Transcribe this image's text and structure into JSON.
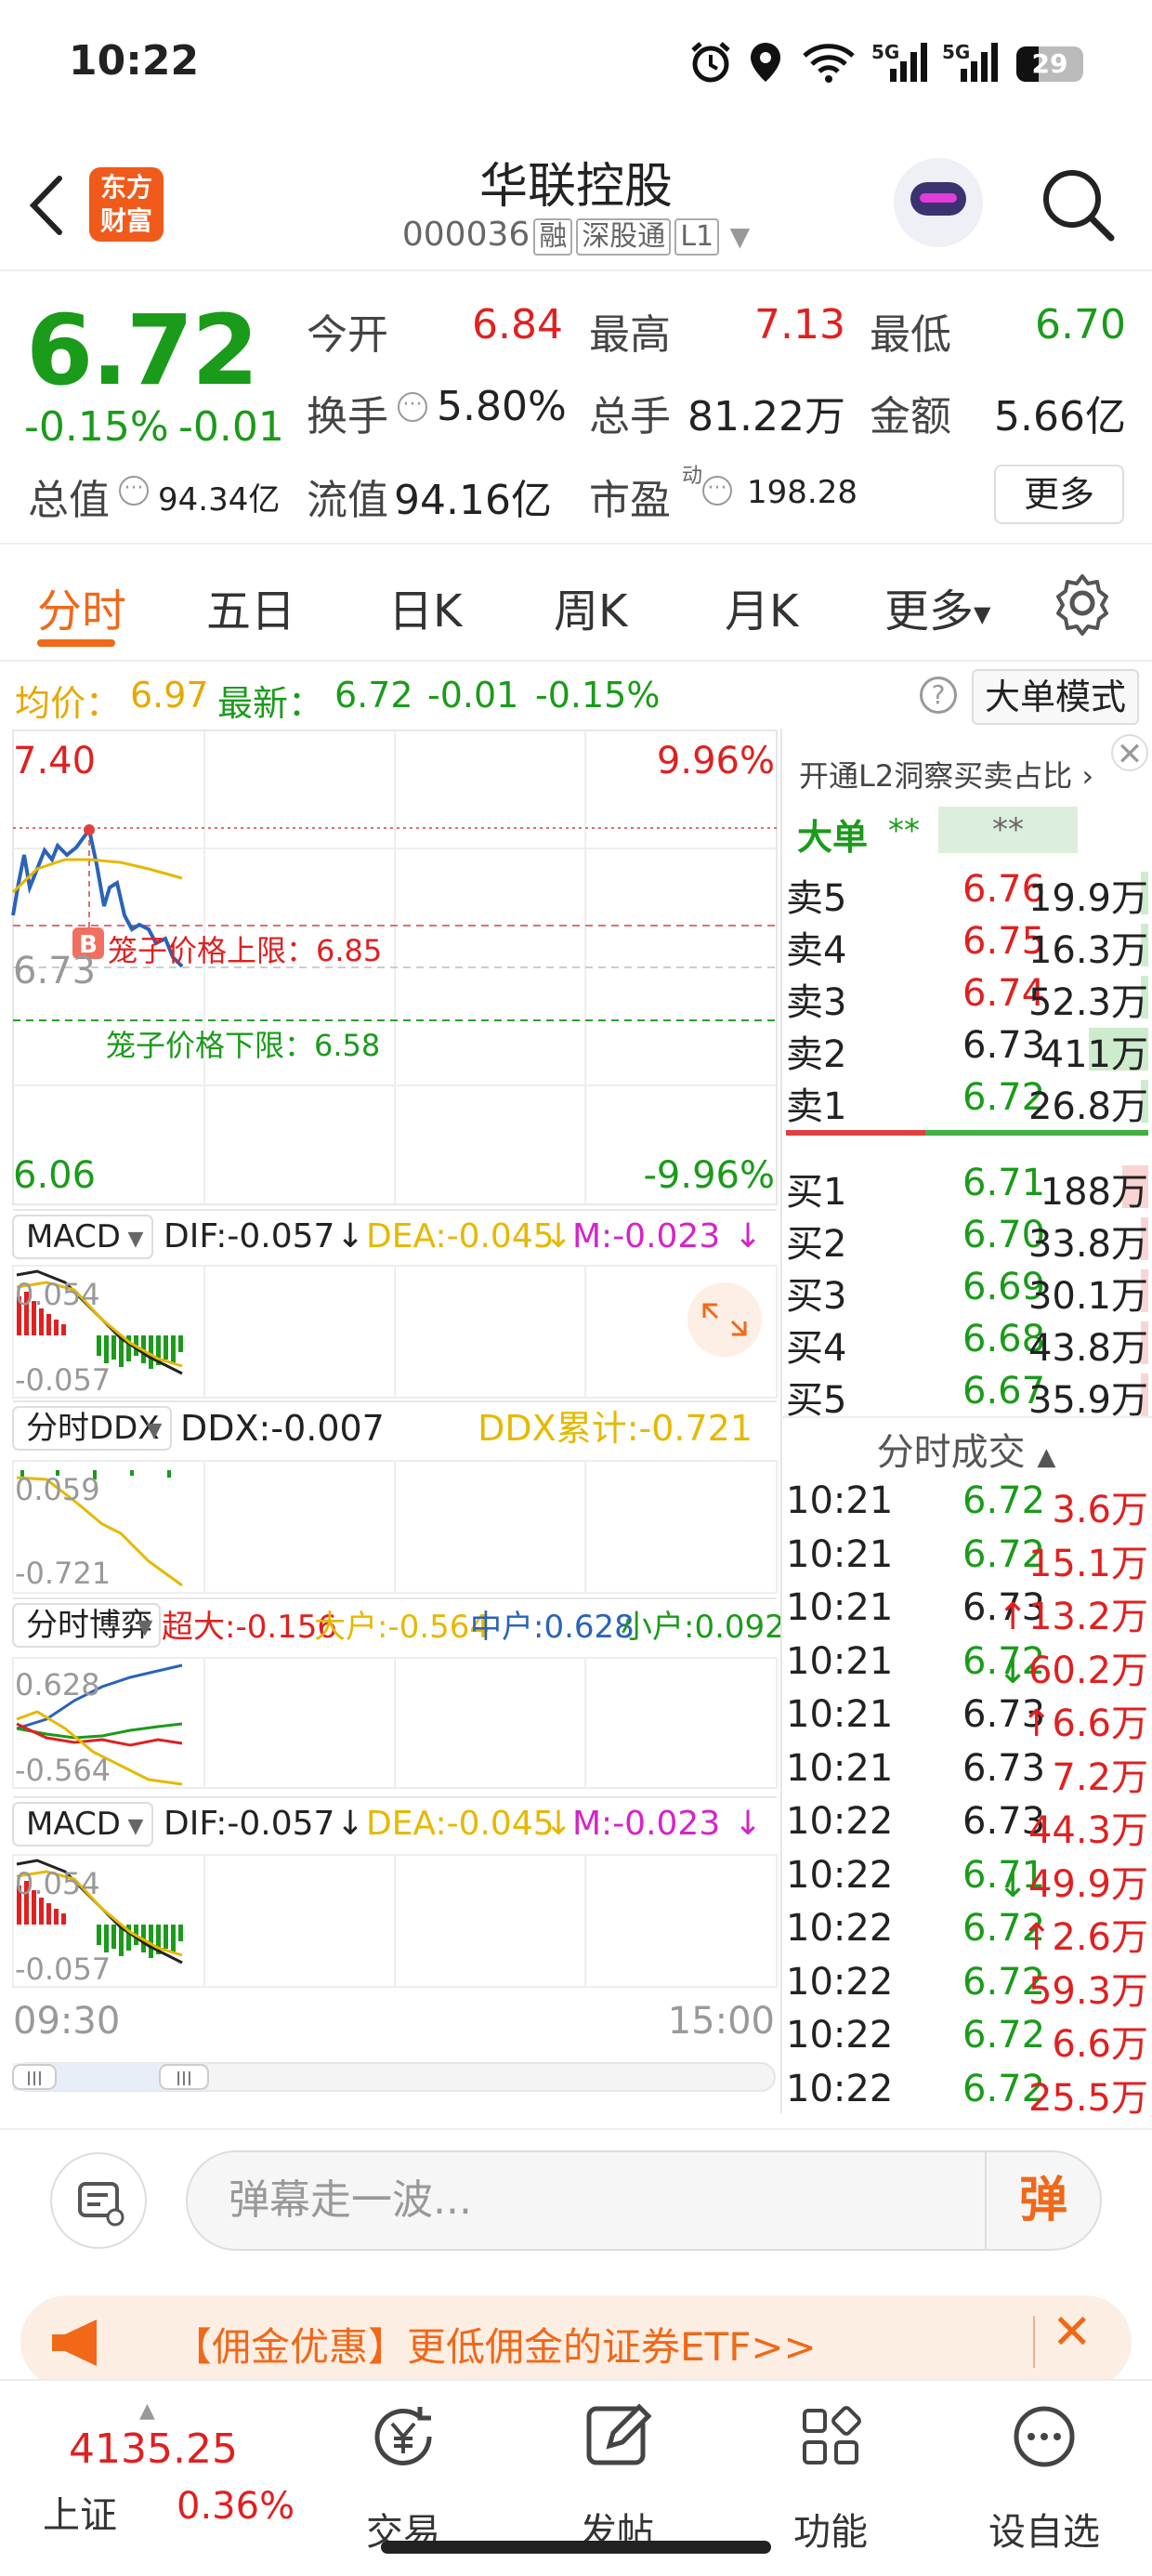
{
  "status_bar": {
    "time": "10:22",
    "network1": "5G",
    "network2": "5G",
    "battery": "29"
  },
  "header": {
    "logo_line1": "东方",
    "logo_line2": "财富",
    "stock_name": "华联控股",
    "stock_code": "000036",
    "tags": [
      "融",
      "深股通",
      "L1"
    ]
  },
  "quote": {
    "last_price": "6.72",
    "change_pct": "-0.15%",
    "change": "-0.01",
    "open_label": "今开",
    "open": "6.84",
    "high_label": "最高",
    "high": "7.13",
    "low_label": "最低",
    "low": "6.70",
    "turnover_label": "换手",
    "turnover": "5.80%",
    "volume_label": "总手",
    "volume": "81.22万",
    "amount_label": "金额",
    "amount": "5.66亿",
    "mktcap_label": "总值",
    "mktcap": "94.34亿",
    "float_label": "流值",
    "float_cap": "94.16亿",
    "pe_label": "市盈",
    "pe_sup": "动",
    "pe": "198.28",
    "more_label": "更多"
  },
  "tabs": [
    "分时",
    "五日",
    "日K",
    "周K",
    "月K",
    "更多"
  ],
  "info_line": {
    "avg_label": "均价：",
    "avg": "6.97",
    "latest_label": "最新：",
    "latest": "6.72",
    "change": "-0.01",
    "pct": "-0.15%",
    "mode_label": "大单模式"
  },
  "chart": {
    "top_price": "7.40",
    "top_pct": "9.96%",
    "bottom_price": "6.06",
    "bottom_pct": "-9.96%",
    "mid_price": "6.73",
    "cage_upper": "笼子价格上限：6.85",
    "cage_lower": "笼子价格下限：6.58",
    "cage_tag": "B",
    "macd1": {
      "name": "MACD",
      "dif": "DIF:-0.057",
      "dea": "DEA:-0.045",
      "m": "M:-0.023",
      "top": "0.054",
      "bottom": "-0.057"
    },
    "ddx": {
      "name": "分时DDX",
      "ddx": "DDX:-0.007",
      "cum": "DDX累计:-0.721",
      "top": "0.059",
      "bottom": "-0.721"
    },
    "game": {
      "name": "分时博弈",
      "super": "超大:-0.156",
      "big": "大户:-0.564",
      "mid": "中户:0.628",
      "small": "小户:0.092",
      "top": "0.628",
      "bottom": "-0.564"
    },
    "macd2": {
      "name": "MACD",
      "dif": "DIF:-0.057",
      "dea": "DEA:-0.045",
      "m": "M:-0.023",
      "top": "0.054",
      "bottom": "-0.057"
    },
    "time_start": "09:30",
    "time_end": "15:00"
  },
  "order_book": {
    "l2_label": "开通L2洞察买卖占比",
    "big_label": "大单",
    "big_val1": "**",
    "big_val2": "**",
    "asks": [
      {
        "label": "卖5",
        "price": "6.76",
        "vol": "19.9万",
        "bar": 0.02
      },
      {
        "label": "卖4",
        "price": "6.75",
        "vol": "16.3万",
        "bar": 0.02
      },
      {
        "label": "卖3",
        "price": "6.74",
        "vol": "52.3万",
        "bar": 0.02
      },
      {
        "label": "卖2",
        "price": "6.73",
        "vol": "411万",
        "bar": 0.16
      },
      {
        "label": "卖1",
        "price": "6.72",
        "vol": "26.8万",
        "bar": 0.02
      }
    ],
    "bids": [
      {
        "label": "买1",
        "price": "6.71",
        "vol": "188万",
        "bar": 0.07
      },
      {
        "label": "买2",
        "price": "6.70",
        "vol": "33.8万",
        "bar": 0.02
      },
      {
        "label": "买3",
        "price": "6.69",
        "vol": "30.1万",
        "bar": 0.02
      },
      {
        "label": "买4",
        "price": "6.68",
        "vol": "43.8万",
        "bar": 0.02
      },
      {
        "label": "买5",
        "price": "6.67",
        "vol": "35.9万",
        "bar": 0.02
      }
    ],
    "trades_label": "分时成交",
    "trades": [
      {
        "time": "10:21",
        "price": "6.72",
        "vol": "3.6万",
        "dir": ""
      },
      {
        "time": "10:21",
        "price": "6.72",
        "vol": "15.1万",
        "dir": ""
      },
      {
        "time": "10:21",
        "price": "6.73",
        "vol": "13.2万",
        "dir": "↑"
      },
      {
        "time": "10:21",
        "price": "6.72",
        "vol": "60.2万",
        "dir": "↓"
      },
      {
        "time": "10:21",
        "price": "6.73",
        "vol": "6.6万",
        "dir": "↑"
      },
      {
        "time": "10:21",
        "price": "6.73",
        "vol": "7.2万",
        "dir": ""
      },
      {
        "time": "10:22",
        "price": "6.73",
        "vol": "44.3万",
        "dir": ""
      },
      {
        "time": "10:22",
        "price": "6.71",
        "vol": "49.9万",
        "dir": "↓"
      },
      {
        "time": "10:22",
        "price": "6.72",
        "vol": "2.6万",
        "dir": "↑"
      },
      {
        "time": "10:22",
        "price": "6.72",
        "vol": "59.3万",
        "dir": ""
      },
      {
        "time": "10:22",
        "price": "6.72",
        "vol": "6.6万",
        "dir": ""
      },
      {
        "time": "10:22",
        "price": "6.72",
        "vol": "25.5万",
        "dir": ""
      }
    ]
  },
  "comment": {
    "placeholder": "弹幕走一波...",
    "danmu_label": "弹"
  },
  "promo": {
    "text": "【佣金优惠】更低佣金的证券ETF>>"
  },
  "bottom_nav": {
    "index_value": "4135.25",
    "index_name": "上证",
    "index_pct": "0.36%",
    "items": [
      "交易",
      "发帖",
      "功能",
      "设自选"
    ]
  },
  "colors": {
    "up": "#e02020",
    "down": "#1a9b1a",
    "accent": "#f06818"
  }
}
